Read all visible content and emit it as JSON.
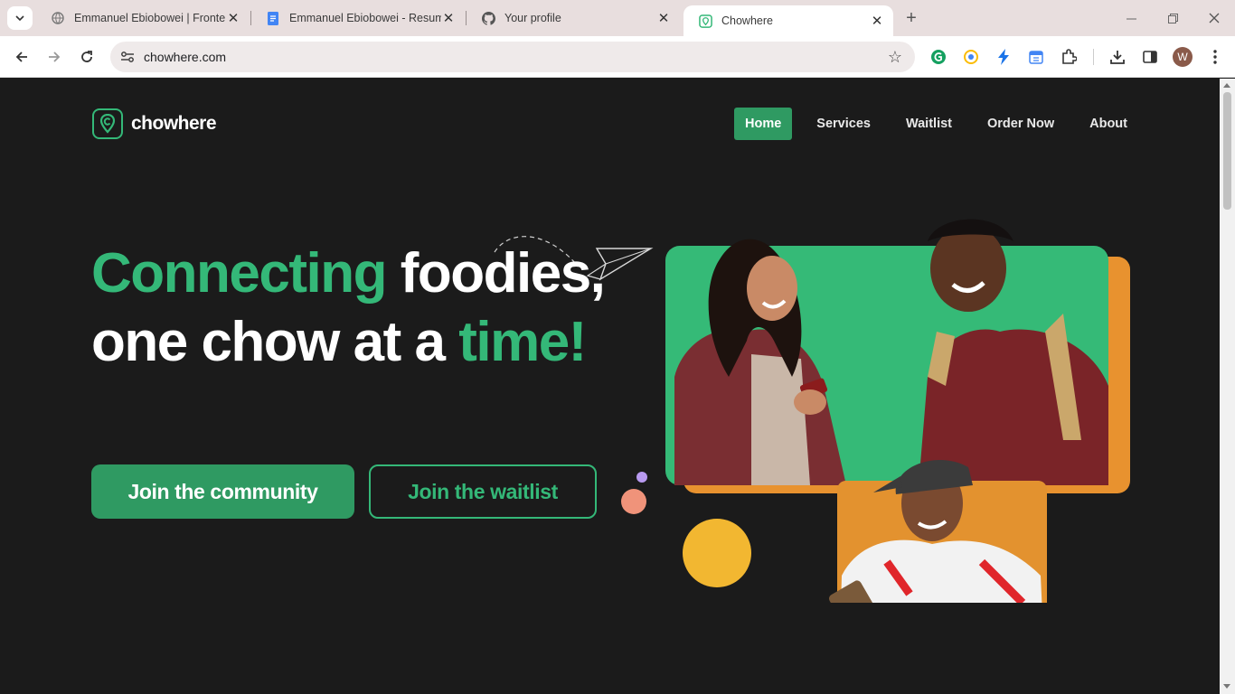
{
  "browser": {
    "tabs": [
      {
        "title": "Emmanuel Ebiobowei | Frontend",
        "icon": "globe-icon"
      },
      {
        "title": "Emmanuel Ebiobowei - Resume",
        "icon": "google-docs-icon"
      },
      {
        "title": "Your profile",
        "icon": "github-icon"
      },
      {
        "title": "Chowhere",
        "icon": "chowhere-favicon",
        "active": true
      }
    ],
    "url": "chowhere.com",
    "profile_initial": "W"
  },
  "site": {
    "logo_text": "chowhere",
    "nav": [
      "Home",
      "Services",
      "Waitlist",
      "Order Now",
      "About"
    ],
    "active_nav": "Home"
  },
  "hero": {
    "line1_green": "Connecting",
    "line1_white": "foodies,",
    "line2_white": "one chow at a",
    "line2_green": "time!",
    "primary_button": "Join the community",
    "secondary_button": "Join the waitlist"
  },
  "colors": {
    "brand_green": "#34b878",
    "button_green": "#2f9a62",
    "orange": "#e8922f",
    "yellow": "#f2b731",
    "background": "#1b1b1b"
  }
}
